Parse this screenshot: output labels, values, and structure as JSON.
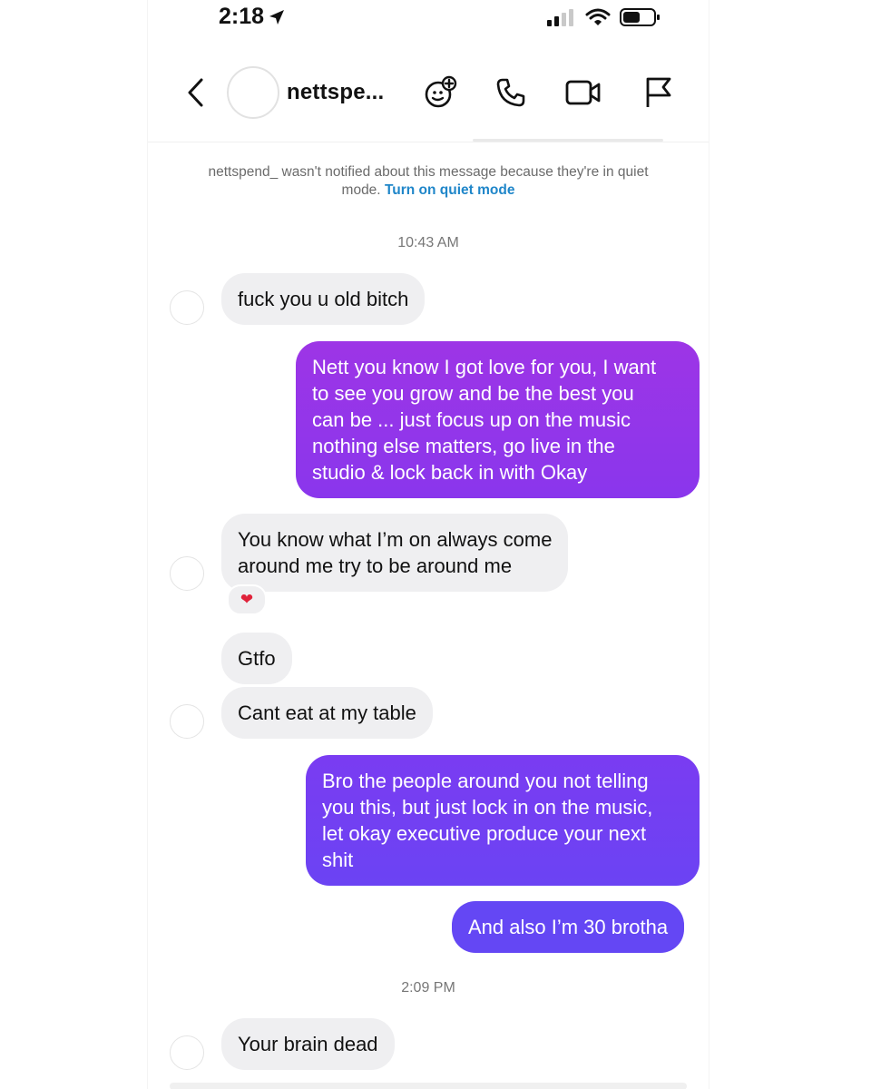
{
  "status_bar": {
    "time": "2:18"
  },
  "header": {
    "username": "nettspe..."
  },
  "notice": {
    "text": "nettspend_ wasn't notified about this message because they're in quiet mode.",
    "link": "Turn on quiet mode"
  },
  "timestamps": [
    "10:43 AM",
    "2:09 PM"
  ],
  "messages": [
    {
      "from": "them",
      "text": "fuck you u old bitch"
    },
    {
      "from": "me",
      "text": "Nett you know I got love for you, I want\nto see you grow and be the best you\ncan be ... just focus up on the music\nnothing else matters, go live in the\nstudio & lock back in with Okay"
    },
    {
      "from": "them",
      "text": "You know what I’m on always come\naround me try to be around me",
      "reaction": "❤"
    },
    {
      "from": "them",
      "text": "Gtfo"
    },
    {
      "from": "them",
      "text": "Cant eat at my table"
    },
    {
      "from": "me",
      "text": "Bro the people around you not telling\nyou this, but just lock in on the music,\nlet okay executive produce your next\nshit"
    },
    {
      "from": "me",
      "text": "And also I’m 30 brotha"
    },
    {
      "from": "them",
      "text": "Your brain dead"
    }
  ],
  "colors": {
    "sent_gradient_top": "#9d35e6",
    "sent_gradient_mid": "#7a3cf2",
    "sent_gradient_bottom": "#6447f4",
    "received_bubble": "#efeff1",
    "link": "#1f86c9"
  },
  "icons": {
    "back": "chevron-left-icon",
    "effects": "sticker-plus-icon",
    "call": "phone-icon",
    "video": "video-camera-icon",
    "report": "flag-icon"
  }
}
